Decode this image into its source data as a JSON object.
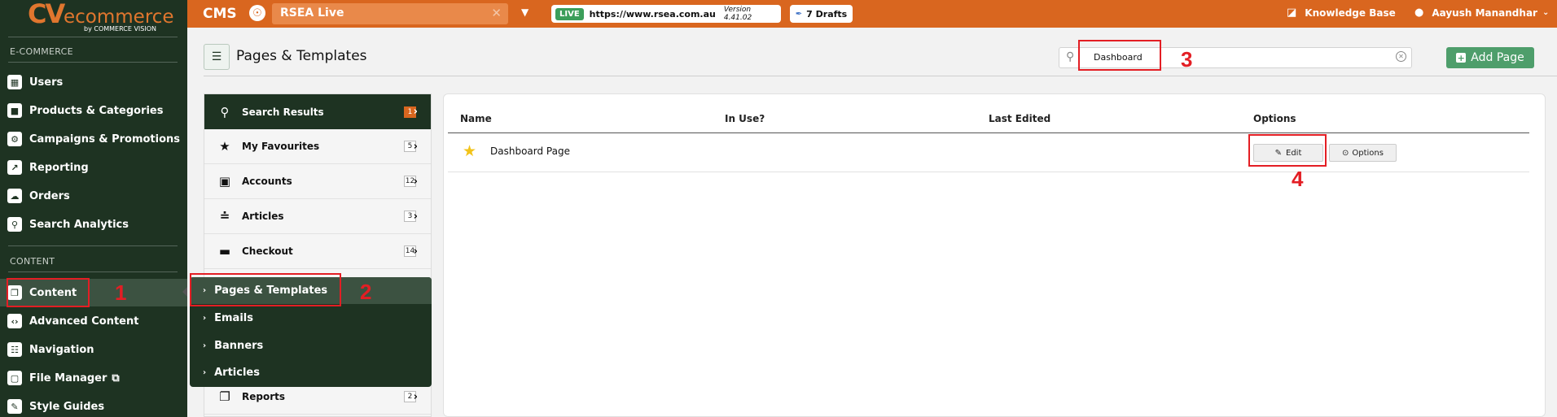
{
  "brand": {
    "logo_mark": "CV",
    "logo_word": "ecommerce",
    "logo_by": "by COMMERCE VISION",
    "accent": "#d9661f",
    "sidebar_bg": "#1e3322"
  },
  "topbar": {
    "app": "CMS",
    "site": "RSEA Live",
    "env_badge": "LIVE",
    "env_url": "https://www.rsea.com.au",
    "version": "Version 4.41.02",
    "drafts": "7 Drafts",
    "knowledge_base": "Knowledge Base",
    "user": "Aayush Manandhar"
  },
  "sidebar": {
    "sections": [
      {
        "title": "E-COMMERCE",
        "items": [
          {
            "label": "Users",
            "icon": "users-icon"
          },
          {
            "label": "Products & Categories",
            "icon": "box-icon"
          },
          {
            "label": "Campaigns & Promotions",
            "icon": "gear-tag-icon"
          },
          {
            "label": "Reporting",
            "icon": "chart-icon"
          },
          {
            "label": "Orders",
            "icon": "cloud-upload-icon"
          },
          {
            "label": "Search Analytics",
            "icon": "search-icon"
          }
        ]
      },
      {
        "title": "CONTENT",
        "items": [
          {
            "label": "Content",
            "icon": "pages-icon",
            "active": true
          },
          {
            "label": "Advanced Content",
            "icon": "code-icon"
          },
          {
            "label": "Navigation",
            "icon": "sitemap-icon"
          },
          {
            "label": "File Manager",
            "icon": "folder-icon"
          },
          {
            "label": "Style Guides",
            "icon": "brush-icon"
          }
        ]
      }
    ]
  },
  "page": {
    "title": "Pages & Templates",
    "search_value": "Dashboard",
    "add_page": "Add Page"
  },
  "categories": [
    {
      "label": "Search Results",
      "count": "1"
    },
    {
      "label": "My Favourites",
      "count": "5"
    },
    {
      "label": "Accounts",
      "count": "12"
    },
    {
      "label": "Articles",
      "count": "3"
    },
    {
      "label": "Checkout",
      "count": "14"
    },
    {
      "label": "Reports",
      "count": "2"
    }
  ],
  "flyout": {
    "items": [
      {
        "label": "Pages & Templates",
        "active": true
      },
      {
        "label": "Emails"
      },
      {
        "label": "Banners"
      },
      {
        "label": "Articles"
      }
    ]
  },
  "table": {
    "headers": [
      "Name",
      "In Use?",
      "Last Edited",
      "Options"
    ],
    "rows": [
      {
        "name": "Dashboard Page",
        "in_use": "",
        "last_edited": "",
        "favourite": true
      }
    ],
    "edit_label": "Edit",
    "options_label": "Options"
  },
  "annotations": {
    "color": "#e31e24",
    "steps": [
      "1",
      "2",
      "3",
      "4"
    ]
  }
}
